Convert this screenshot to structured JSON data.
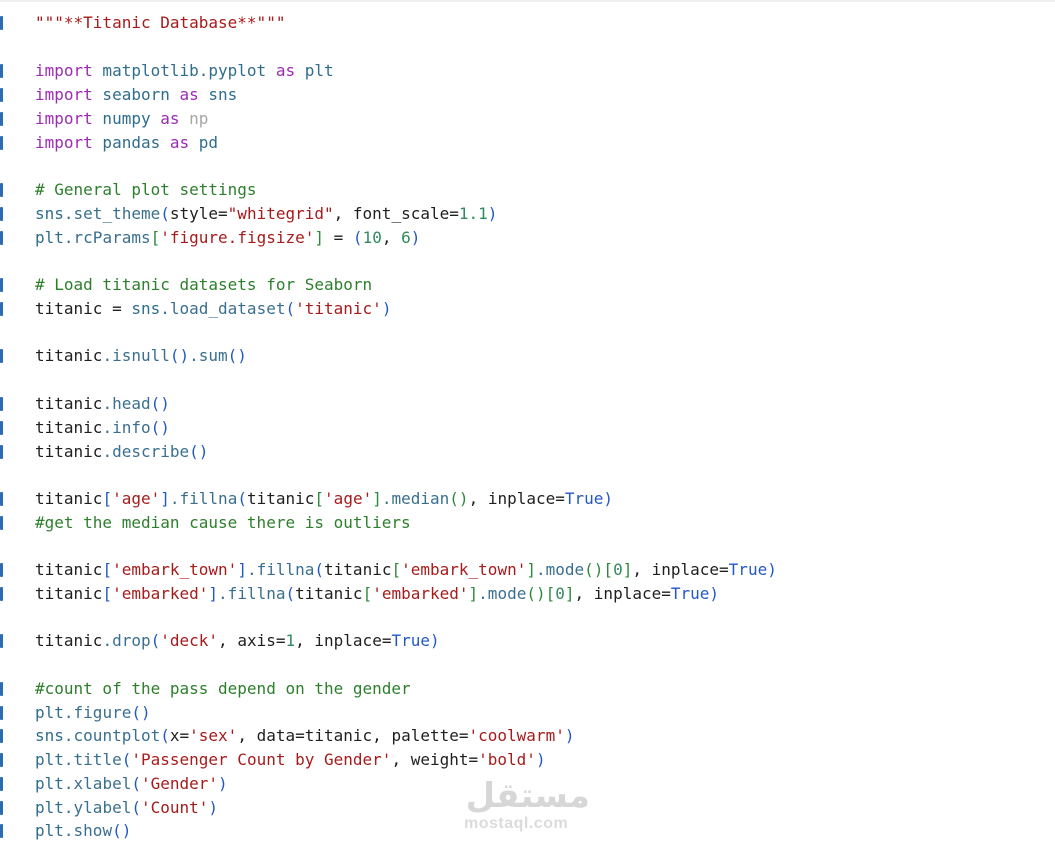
{
  "editor": {
    "lines": [
      {
        "segments": [
          {
            "t": "\"\"\"**Titanic Database**\"\"\"",
            "c": "str"
          }
        ]
      },
      {
        "segments": [
          {
            "t": "import",
            "c": "kw"
          },
          {
            "t": " matplotlib.pyplot ",
            "c": "mod"
          },
          {
            "t": "as",
            "c": "kw"
          },
          {
            "t": " plt",
            "c": "mod"
          }
        ]
      },
      {
        "segments": [
          {
            "t": "import",
            "c": "kw"
          },
          {
            "t": " seaborn ",
            "c": "mod"
          },
          {
            "t": "as",
            "c": "kw"
          },
          {
            "t": " sns",
            "c": "mod"
          }
        ]
      },
      {
        "segments": [
          {
            "t": "import",
            "c": "kw"
          },
          {
            "t": " numpy ",
            "c": "mod"
          },
          {
            "t": "as",
            "c": "kw"
          },
          {
            "t": " np",
            "c": "dim"
          }
        ]
      },
      {
        "segments": [
          {
            "t": "import",
            "c": "kw"
          },
          {
            "t": " pandas ",
            "c": "mod"
          },
          {
            "t": "as",
            "c": "kw"
          },
          {
            "t": " pd",
            "c": "mod"
          }
        ]
      },
      {
        "segments": [
          {
            "t": "# General plot settings",
            "c": "cm"
          }
        ]
      },
      {
        "segments": [
          {
            "t": "sns",
            "c": "mod"
          },
          {
            "t": ".set_theme",
            "c": "fn"
          },
          {
            "t": "(",
            "c": "paren"
          },
          {
            "t": "style=",
            "c": "var"
          },
          {
            "t": "\"whitegrid\"",
            "c": "str"
          },
          {
            "t": ", font_scale=",
            "c": "var"
          },
          {
            "t": "1.1",
            "c": "num"
          },
          {
            "t": ")",
            "c": "paren"
          }
        ]
      },
      {
        "segments": [
          {
            "t": "plt",
            "c": "mod"
          },
          {
            "t": ".rcParams",
            "c": "fn"
          },
          {
            "t": "[",
            "c": "bracket"
          },
          {
            "t": "'figure.figsize'",
            "c": "str"
          },
          {
            "t": "]",
            "c": "bracket"
          },
          {
            "t": " = ",
            "c": "op"
          },
          {
            "t": "(",
            "c": "paren"
          },
          {
            "t": "10",
            "c": "num"
          },
          {
            "t": ", ",
            "c": "op"
          },
          {
            "t": "6",
            "c": "num"
          },
          {
            "t": ")",
            "c": "paren"
          }
        ]
      },
      {
        "segments": [
          {
            "t": "# Load titanic datasets for Seaborn",
            "c": "cm"
          }
        ]
      },
      {
        "segments": [
          {
            "t": "titanic = ",
            "c": "var"
          },
          {
            "t": "sns",
            "c": "mod"
          },
          {
            "t": ".load_dataset",
            "c": "fn"
          },
          {
            "t": "(",
            "c": "paren"
          },
          {
            "t": "'titanic'",
            "c": "str"
          },
          {
            "t": ")",
            "c": "paren"
          }
        ]
      },
      {
        "segments": [
          {
            "t": "titanic",
            "c": "var"
          },
          {
            "t": ".isnull",
            "c": "fn"
          },
          {
            "t": "()",
            "c": "paren"
          },
          {
            "t": ".sum",
            "c": "fn"
          },
          {
            "t": "()",
            "c": "paren"
          }
        ]
      },
      {
        "segments": [
          {
            "t": "titanic",
            "c": "var"
          },
          {
            "t": ".head",
            "c": "fn"
          },
          {
            "t": "()",
            "c": "paren"
          }
        ]
      },
      {
        "segments": [
          {
            "t": "titanic",
            "c": "var"
          },
          {
            "t": ".info",
            "c": "fn"
          },
          {
            "t": "()",
            "c": "paren"
          }
        ]
      },
      {
        "segments": [
          {
            "t": "titanic",
            "c": "var"
          },
          {
            "t": ".describe",
            "c": "fn"
          },
          {
            "t": "()",
            "c": "paren"
          }
        ]
      },
      {
        "segments": [
          {
            "t": "titanic",
            "c": "var"
          },
          {
            "t": "[",
            "c": "paren"
          },
          {
            "t": "'age'",
            "c": "str"
          },
          {
            "t": "]",
            "c": "paren"
          },
          {
            "t": ".fillna",
            "c": "fn"
          },
          {
            "t": "(",
            "c": "paren"
          },
          {
            "t": "titanic",
            "c": "var"
          },
          {
            "t": "[",
            "c": "bracket"
          },
          {
            "t": "'age'",
            "c": "str"
          },
          {
            "t": "]",
            "c": "bracket"
          },
          {
            "t": ".median",
            "c": "fn"
          },
          {
            "t": "()",
            "c": "bracket"
          },
          {
            "t": ", inplace=",
            "c": "var"
          },
          {
            "t": "True",
            "c": "paren"
          },
          {
            "t": ")",
            "c": "paren"
          }
        ]
      },
      {
        "segments": [
          {
            "t": "#get the median cause there is outliers",
            "c": "cm"
          }
        ]
      },
      {
        "segments": [
          {
            "t": "titanic",
            "c": "var"
          },
          {
            "t": "[",
            "c": "paren"
          },
          {
            "t": "'embark_town'",
            "c": "str"
          },
          {
            "t": "]",
            "c": "paren"
          },
          {
            "t": ".fillna",
            "c": "fn"
          },
          {
            "t": "(",
            "c": "paren"
          },
          {
            "t": "titanic",
            "c": "var"
          },
          {
            "t": "[",
            "c": "bracket"
          },
          {
            "t": "'embark_town'",
            "c": "str"
          },
          {
            "t": "]",
            "c": "bracket"
          },
          {
            "t": ".mode",
            "c": "fn"
          },
          {
            "t": "()",
            "c": "bracket"
          },
          {
            "t": "[",
            "c": "bracket"
          },
          {
            "t": "0",
            "c": "num"
          },
          {
            "t": "]",
            "c": "bracket"
          },
          {
            "t": ", inplace=",
            "c": "var"
          },
          {
            "t": "True",
            "c": "paren"
          },
          {
            "t": ")",
            "c": "paren"
          }
        ]
      },
      {
        "segments": [
          {
            "t": "titanic",
            "c": "var"
          },
          {
            "t": "[",
            "c": "paren"
          },
          {
            "t": "'embarked'",
            "c": "str"
          },
          {
            "t": "]",
            "c": "paren"
          },
          {
            "t": ".fillna",
            "c": "fn"
          },
          {
            "t": "(",
            "c": "paren"
          },
          {
            "t": "titanic",
            "c": "var"
          },
          {
            "t": "[",
            "c": "bracket"
          },
          {
            "t": "'embarked'",
            "c": "str"
          },
          {
            "t": "]",
            "c": "bracket"
          },
          {
            "t": ".mode",
            "c": "fn"
          },
          {
            "t": "()",
            "c": "bracket"
          },
          {
            "t": "[",
            "c": "bracket"
          },
          {
            "t": "0",
            "c": "num"
          },
          {
            "t": "]",
            "c": "bracket"
          },
          {
            "t": ", inplace=",
            "c": "var"
          },
          {
            "t": "True",
            "c": "paren"
          },
          {
            "t": ")",
            "c": "paren"
          }
        ]
      },
      {
        "segments": [
          {
            "t": "titanic",
            "c": "var"
          },
          {
            "t": ".drop",
            "c": "fn"
          },
          {
            "t": "(",
            "c": "paren"
          },
          {
            "t": "'deck'",
            "c": "str"
          },
          {
            "t": ", axis=",
            "c": "var"
          },
          {
            "t": "1",
            "c": "num"
          },
          {
            "t": ", inplace=",
            "c": "var"
          },
          {
            "t": "True",
            "c": "paren"
          },
          {
            "t": ")",
            "c": "paren"
          }
        ]
      },
      {
        "segments": [
          {
            "t": "#count of the pass depend on the gender",
            "c": "cm"
          }
        ]
      },
      {
        "segments": [
          {
            "t": "plt",
            "c": "mod"
          },
          {
            "t": ".figure",
            "c": "fn"
          },
          {
            "t": "()",
            "c": "paren"
          }
        ]
      },
      {
        "segments": [
          {
            "t": "sns",
            "c": "mod"
          },
          {
            "t": ".countplot",
            "c": "fn"
          },
          {
            "t": "(",
            "c": "paren"
          },
          {
            "t": "x=",
            "c": "var"
          },
          {
            "t": "'sex'",
            "c": "str"
          },
          {
            "t": ", data=titanic, palette=",
            "c": "var"
          },
          {
            "t": "'coolwarm'",
            "c": "str"
          },
          {
            "t": ")",
            "c": "paren"
          }
        ]
      },
      {
        "segments": [
          {
            "t": "plt",
            "c": "mod"
          },
          {
            "t": ".title",
            "c": "fn"
          },
          {
            "t": "(",
            "c": "paren"
          },
          {
            "t": "'Passenger Count by Gender'",
            "c": "str"
          },
          {
            "t": ", weight=",
            "c": "var"
          },
          {
            "t": "'bold'",
            "c": "str"
          },
          {
            "t": ")",
            "c": "paren"
          }
        ]
      },
      {
        "segments": [
          {
            "t": "plt",
            "c": "mod"
          },
          {
            "t": ".xlabel",
            "c": "fn"
          },
          {
            "t": "(",
            "c": "paren"
          },
          {
            "t": "'Gender'",
            "c": "str"
          },
          {
            "t": ")",
            "c": "paren"
          }
        ]
      },
      {
        "segments": [
          {
            "t": "plt",
            "c": "mod"
          },
          {
            "t": ".ylabel",
            "c": "fn"
          },
          {
            "t": "(",
            "c": "paren"
          },
          {
            "t": "'Count'",
            "c": "str"
          },
          {
            "t": ")",
            "c": "paren"
          }
        ]
      },
      {
        "segments": [
          {
            "t": "plt",
            "c": "mod"
          },
          {
            "t": ".show",
            "c": "fn"
          },
          {
            "t": "()",
            "c": "paren"
          }
        ]
      }
    ]
  },
  "watermark": {
    "domain_text": "mostaql.com",
    "logo_text": "مستقل"
  },
  "colors": {
    "keyword": "#9b2bb3",
    "string": "#a61b1b",
    "comment": "#2d7f2d",
    "number": "#2f8a5f",
    "paren": "#2359c2",
    "gutter_mark": "#2d6bb3"
  }
}
